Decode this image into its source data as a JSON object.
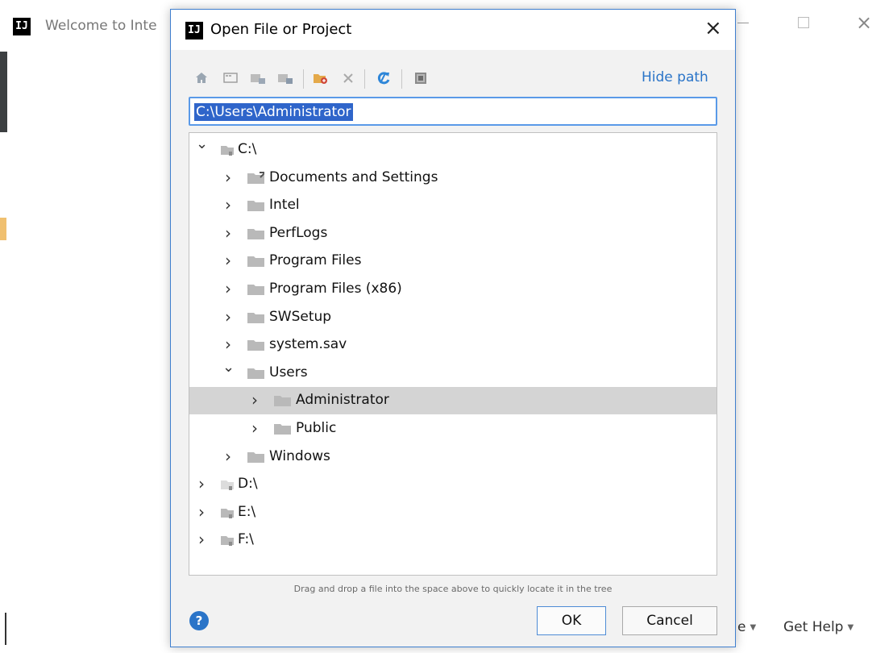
{
  "background_window": {
    "title": "Welcome to Inte",
    "bottom_menu": {
      "configure_label": "e",
      "get_help_label": "Get Help"
    }
  },
  "dialog": {
    "title": "Open File or Project",
    "close_glyph": "×",
    "hide_path_label": "Hide path",
    "path_value": "C:\\Users\\Administrator",
    "hint": "Drag and drop a file into the space above to quickly locate it in the tree",
    "ok_label": "OK",
    "cancel_label": "Cancel",
    "help_glyph": "?",
    "toolbar_icons": [
      "home-icon",
      "desktop-icon",
      "project-icon",
      "module-icon",
      "new-folder-icon",
      "delete-icon",
      "refresh-icon",
      "show-hidden-icon"
    ]
  },
  "tree": [
    {
      "label": "C:\\",
      "level": 0,
      "expanded": true,
      "drive": true
    },
    {
      "label": "Documents and Settings",
      "level": 1,
      "expanded": false,
      "link": true
    },
    {
      "label": "Intel",
      "level": 1,
      "expanded": false
    },
    {
      "label": "PerfLogs",
      "level": 1,
      "expanded": false
    },
    {
      "label": "Program Files",
      "level": 1,
      "expanded": false
    },
    {
      "label": "Program Files (x86)",
      "level": 1,
      "expanded": false
    },
    {
      "label": "SWSetup",
      "level": 1,
      "expanded": false
    },
    {
      "label": "system.sav",
      "level": 1,
      "expanded": false
    },
    {
      "label": "Users",
      "level": 1,
      "expanded": true
    },
    {
      "label": "Administrator",
      "level": 2,
      "expanded": false,
      "selected": true
    },
    {
      "label": "Public",
      "level": 2,
      "expanded": false
    },
    {
      "label": "Windows",
      "level": 1,
      "expanded": false
    },
    {
      "label": "D:\\",
      "level": 0,
      "expanded": false,
      "drive": true
    },
    {
      "label": "E:\\",
      "level": 0,
      "expanded": false,
      "drive": true
    },
    {
      "label": "F:\\",
      "level": 0,
      "expanded": false,
      "drive": true
    }
  ],
  "colors": {
    "accent": "#2a74c8",
    "selection": "#d4d4d4",
    "path_selection": "#2f65ca",
    "folder": "#b9b9b9"
  }
}
